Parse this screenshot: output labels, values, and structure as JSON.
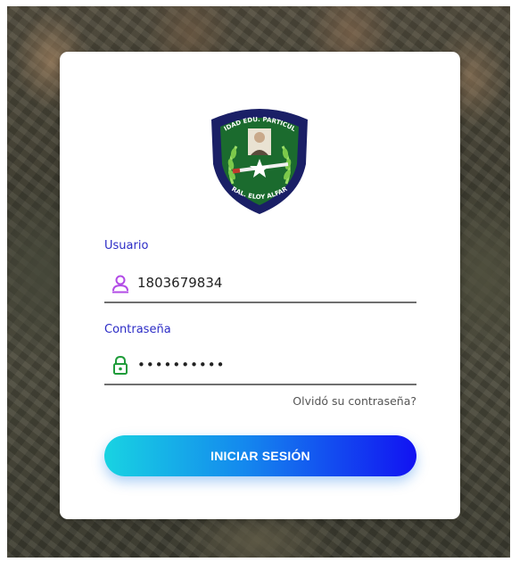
{
  "logo": {
    "top_text": "UNIDAD EDU. PARTICULAR",
    "bottom_text": "GRAL. ELOY ALFARO"
  },
  "username": {
    "label": "Usuario",
    "value": "1803679834",
    "icon": "user-icon"
  },
  "password": {
    "label": "Contraseña",
    "value": "1234567890",
    "icon": "lock-icon"
  },
  "forgot_link": "Olvidó su contraseña?",
  "login_button": "INICIAR SESIÓN",
  "colors": {
    "label": "#2c2cc6",
    "icon_user": "#b24be6",
    "icon_lock": "#1f9c3a",
    "button_start": "#18d3e2",
    "button_end": "#1212f2",
    "shield_green": "#1b6b2e",
    "shield_navy": "#1a1f66"
  }
}
